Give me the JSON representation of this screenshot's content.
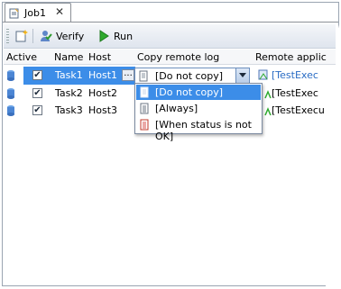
{
  "tab": {
    "title": "Job1",
    "close": "✕"
  },
  "toolbar": {
    "verify": "Verify",
    "run": "Run"
  },
  "columns": [
    "Active",
    "Name",
    "Host",
    "Copy remote log",
    "Remote applic"
  ],
  "rows": [
    {
      "name": "Task1",
      "host": "Host1",
      "log": "[Do not copy]",
      "app": "[TestExec"
    },
    {
      "name": "Task2",
      "host": "Host2",
      "log": "",
      "app": "[TestExec"
    },
    {
      "name": "Task3",
      "host": "Host3",
      "log": "",
      "app": "[TestExecu"
    }
  ],
  "dropdown": {
    "selected": "[Do not copy]",
    "options": [
      "[Do not copy]",
      "[Always]",
      "[When status is not OK]"
    ]
  },
  "ellipsis": "...",
  "colors": {
    "selection": "#3c8de8",
    "accent": "#2a6cc4"
  }
}
